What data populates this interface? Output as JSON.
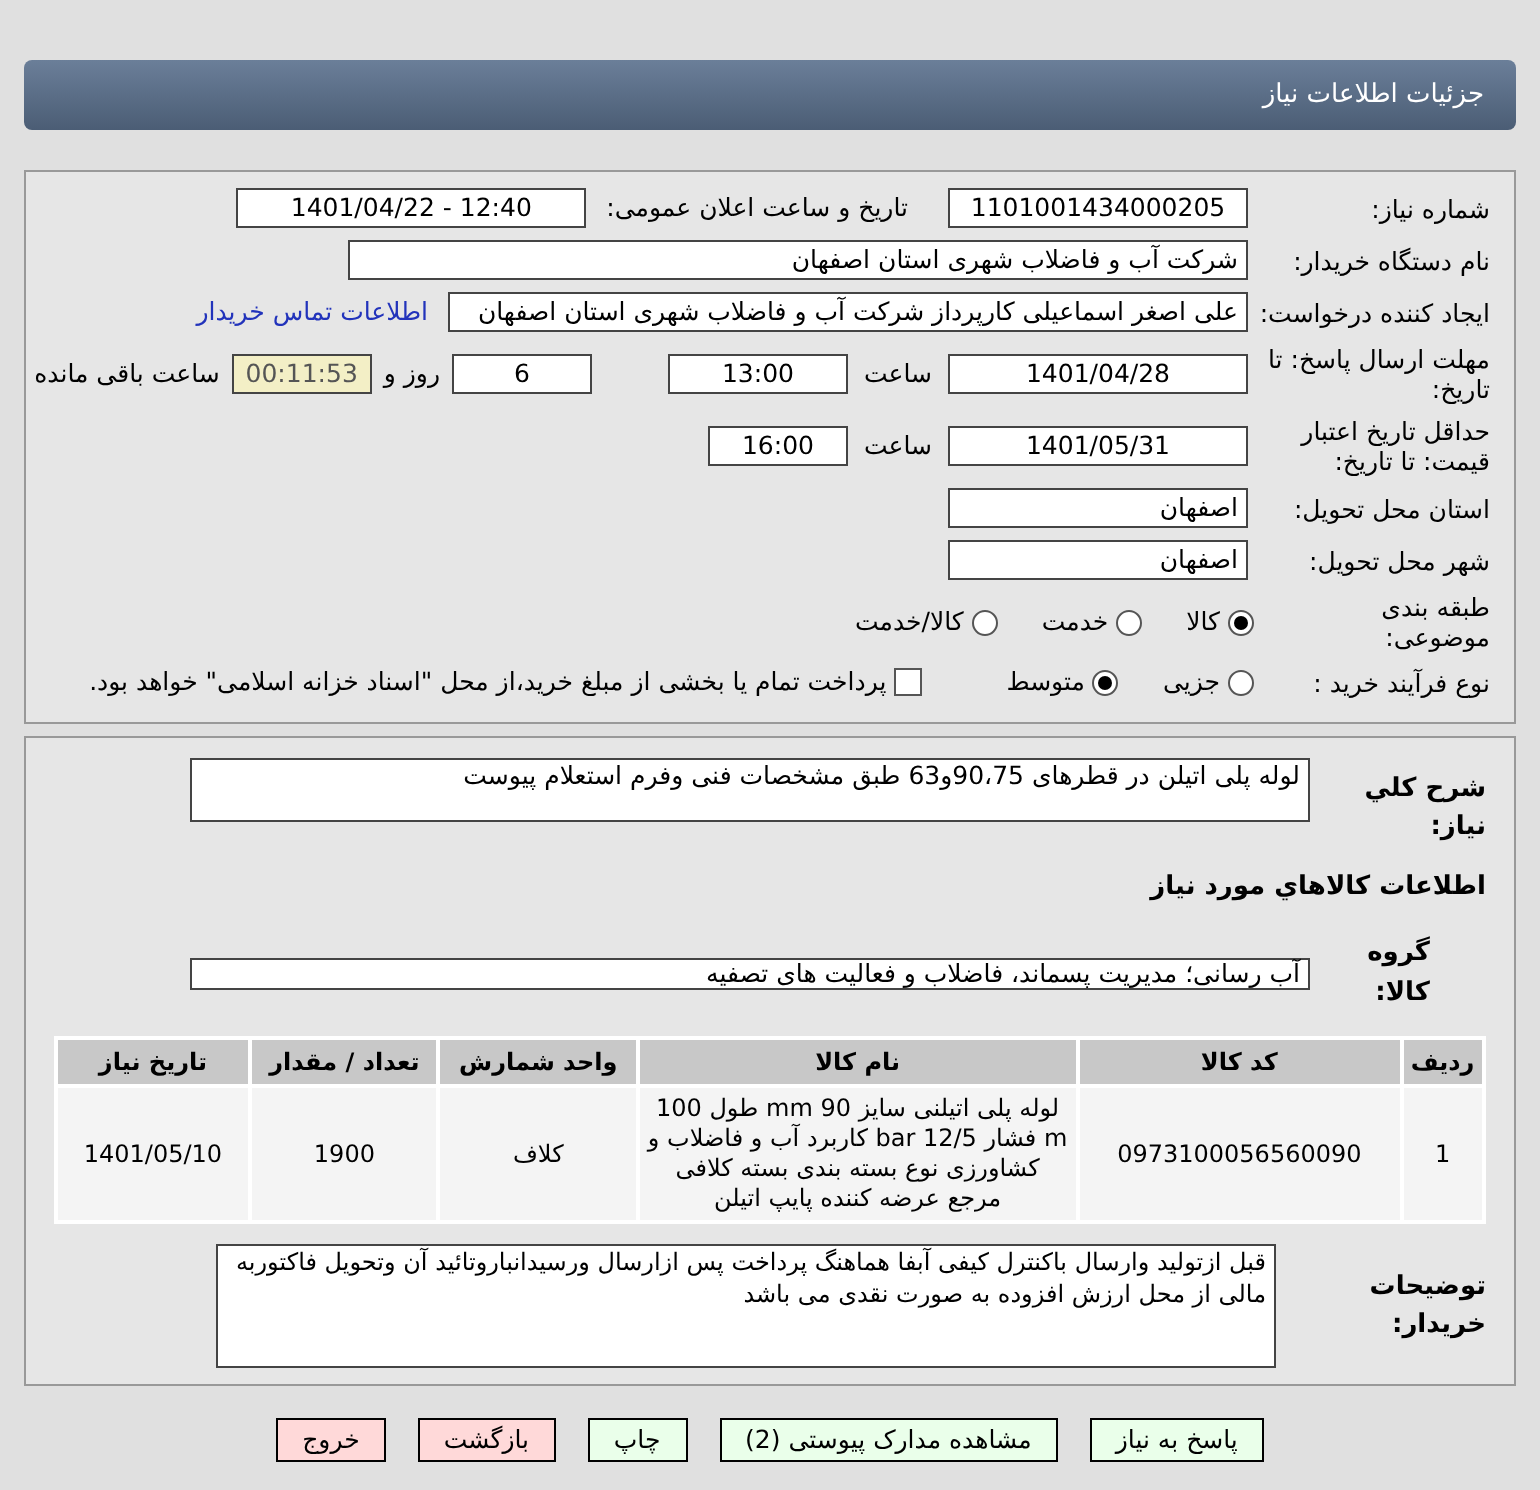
{
  "header": {
    "title": "جزئیات اطلاعات نیاز"
  },
  "need_number": {
    "label": "شماره نیاز:",
    "value": "1101001434000205"
  },
  "announce": {
    "label": "تاریخ و ساعت اعلان عمومی:",
    "value": "1401/04/22 - 12:40"
  },
  "buyer": {
    "label": "نام دستگاه خریدار:",
    "value": "شرکت آب و فاضلاب شهری استان اصفهان"
  },
  "requester": {
    "label": "ایجاد کننده درخواست:",
    "value": "علی اصغر اسماعیلی کارپرداز شرکت آب و فاضلاب شهری استان اصفهان",
    "link": "اطلاعات تماس خریدار"
  },
  "deadline": {
    "label": "مهلت ارسال پاسخ: تا تاریخ:",
    "date": "1401/04/28",
    "time_label": "ساعت",
    "time": "13:00",
    "days": "6",
    "days_label": "روز و",
    "remaining": "00:11:53",
    "remaining_label": "ساعت باقی مانده"
  },
  "validity": {
    "label": "حداقل تاریخ اعتبار قیمت: تا تاریخ:",
    "date": "1401/05/31",
    "time_label": "ساعت",
    "time": "16:00"
  },
  "province": {
    "label": "استان محل تحویل:",
    "value": "اصفهان"
  },
  "city": {
    "label": "شهر محل تحویل:",
    "value": "اصفهان"
  },
  "category": {
    "label": "طبقه بندی موضوعی:",
    "options": [
      {
        "label": "کالا",
        "selected": true
      },
      {
        "label": "خدمت",
        "selected": false
      },
      {
        "label": "کالا/خدمت",
        "selected": false
      }
    ]
  },
  "process": {
    "label": "نوع فرآیند خرید :",
    "options": [
      {
        "label": "جزیی",
        "selected": false
      },
      {
        "label": "متوسط",
        "selected": true
      }
    ],
    "checkbox": {
      "label": "پرداخت تمام یا بخشی از مبلغ خرید،از محل \"اسناد خزانه اسلامی\" خواهد بود.",
      "checked": false
    }
  },
  "summary": {
    "label": "شرح کلي نياز:",
    "value": "لوله پلی اتیلن در قطرهای 90،75و63 طبق مشخصات فنی وفرم استعلام پیوست"
  },
  "goods_title": "اطلاعات کالاهاي مورد نياز",
  "group": {
    "label": "گروه کالا:",
    "value": "آب رسانی؛ مدیریت پسماند، فاضلاب و فعالیت های تصفیه"
  },
  "table": {
    "columns": [
      "ردیف",
      "کد کالا",
      "نام کالا",
      "واحد شمارش",
      "تعداد / مقدار",
      "تاریخ نیاز"
    ],
    "rows": [
      [
        "1",
        "0973100056560090",
        "لوله پلی اتیلنی سایز 90 mm طول 100 m فشار 12/5 bar کاربرد آب و فاضلاب و کشاورزی نوع بسته بندی بسته کلافی مرجع عرضه کننده پایپ اتیلن",
        "کلاف",
        "1900",
        "1401/05/10"
      ]
    ]
  },
  "notes": {
    "label": "توضیحات خریدار:",
    "value": "قبل ازتولید وارسال باکنترل کیفی آبفا هماهنگ پرداخت پس ازارسال ورسیدانباروتائید آن وتحویل فاکتوربه مالی از محل ارزش افزوده به صورت نقدی می باشد"
  },
  "buttons": [
    {
      "label": "پاسخ به نیاز",
      "kind": "primary"
    },
    {
      "label": "مشاهده مدارک پیوستی (2)",
      "kind": "primary"
    },
    {
      "label": "چاپ",
      "kind": "primary"
    },
    {
      "label": "بازگشت",
      "kind": "danger"
    },
    {
      "label": "خروج",
      "kind": "danger"
    }
  ]
}
